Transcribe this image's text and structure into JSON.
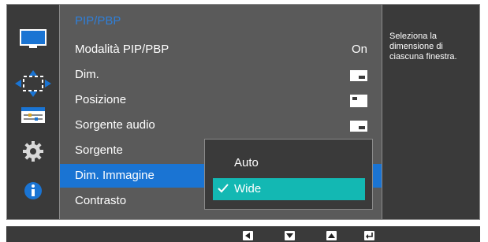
{
  "sidebar": {
    "items": [
      {
        "icon": "monitor-icon"
      },
      {
        "icon": "move-arrows-icon",
        "active": true
      },
      {
        "icon": "settings-list-icon"
      },
      {
        "icon": "gear-icon"
      },
      {
        "icon": "info-icon"
      }
    ]
  },
  "menu": {
    "title": "PIP/PBP",
    "rows": [
      {
        "label": "Modalità PIP/PBP",
        "value": "On"
      },
      {
        "label": "Dim.",
        "icon": "window-size-icon"
      },
      {
        "label": "Posizione",
        "icon": "window-position-icon"
      },
      {
        "label": "Sorgente audio",
        "icon": "audio-source-window-icon"
      },
      {
        "label": "Sorgente"
      },
      {
        "label": "Dim. Immagine",
        "selected": true
      },
      {
        "label": "Contrasto"
      }
    ]
  },
  "help": {
    "text": "Seleziona la dimensione di ciascuna finestra."
  },
  "popup": {
    "options": [
      {
        "label": "Auto",
        "selected": false
      },
      {
        "label": "Wide",
        "selected": true
      }
    ]
  },
  "bottom_bar": {
    "keys": [
      "left-arrow-key-icon",
      "down-arrow-key-icon",
      "up-arrow-key-icon",
      "enter-key-icon"
    ]
  },
  "colors": {
    "title_blue": "#2f7fd9",
    "selected_blue": "#1a74d3",
    "option_teal": "#13b8b3",
    "panel_gray": "#5a5a5a",
    "dark_gray": "#3a3a3a"
  }
}
